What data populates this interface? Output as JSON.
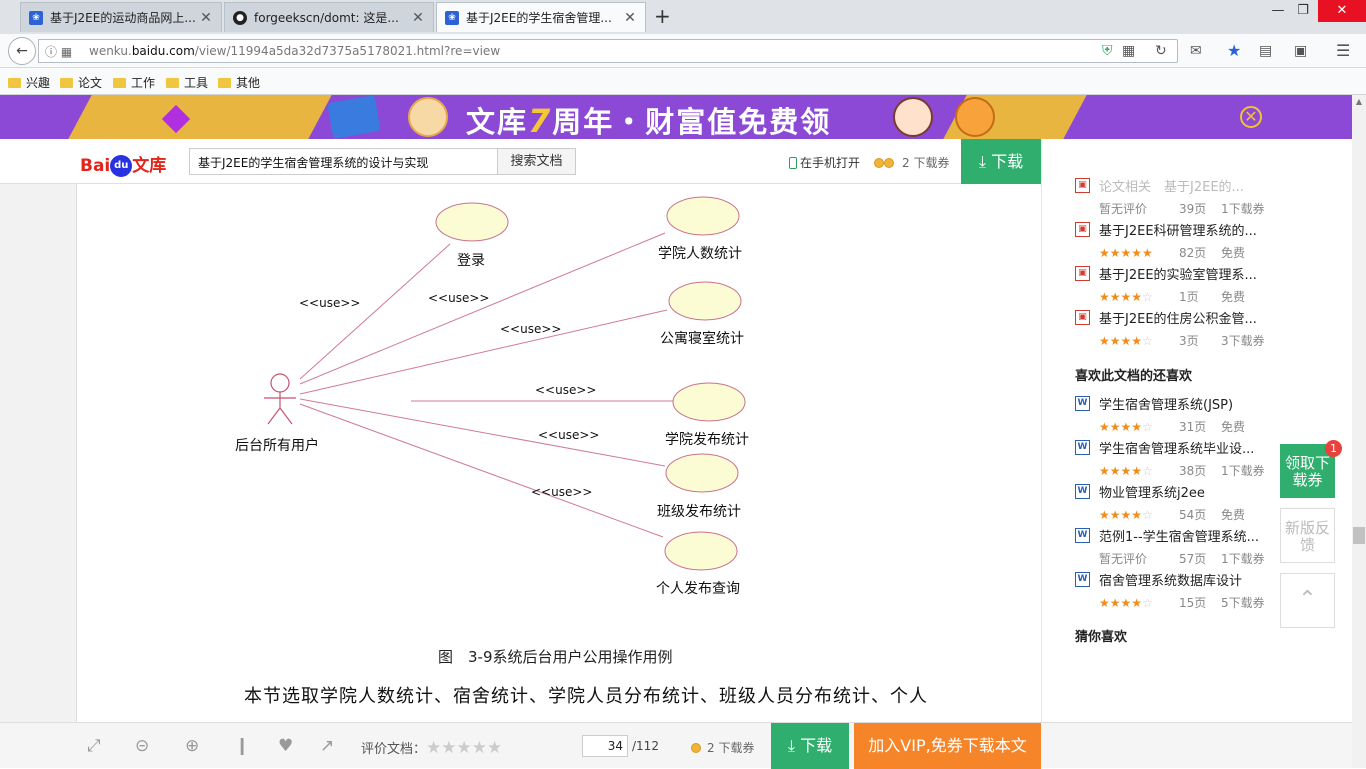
{
  "browser": {
    "tabs": [
      {
        "title": "基于J2EE的运动商品网上..."
      },
      {
        "title": "forgeekscn/domt: 这是..."
      },
      {
        "title": "基于J2EE的学生宿舍管理..."
      }
    ],
    "url_prefix": "wenku.",
    "url_domain": "baidu.com",
    "url_path": "/view/11994a5da32d7375a5178021.html?re=view",
    "bookmarks": [
      "兴趣",
      "论文",
      "工作",
      "工具",
      "其他"
    ]
  },
  "banner": {
    "headline_left": "文库",
    "headline_num": "7",
    "headline_right": "周年・财富值免费领"
  },
  "header": {
    "logo_text": "Bai",
    "logo_du": "du",
    "logo_wk": "文库",
    "search_value": "基于J2EE的学生宿舍管理系统的设计与实现",
    "search_button": "搜索文档",
    "mobile_open": "在手机打开",
    "quota": "2 下载券",
    "download": "下载"
  },
  "diagram": {
    "actor": "后台所有用户",
    "use_label": "<<use>>",
    "usecases": [
      "登录",
      "学院人数统计",
      "公寓寝室统计",
      "学院发布统计",
      "班级发布统计",
      "个人发布查询"
    ]
  },
  "document": {
    "caption": "图　3-9系统后台用户公用操作用例",
    "body": "本节选取学院人数统计、宿舍统计、学院人员分布统计、班级人员分布统计、个人"
  },
  "sidebar": {
    "faded_item": "论文相关　基于J2EE的...",
    "related": [
      {
        "title": "基于J2EE科研管理系统的...",
        "rating": 4.5,
        "pages": "82页",
        "cost": "免费"
      },
      {
        "title": "基于J2EE的实验室管理系...",
        "rating": 3.5,
        "pages": "1页",
        "cost": "免费"
      },
      {
        "title": "基于J2EE的住房公积金管...",
        "rating": 3.5,
        "pages": "3页",
        "cost": "3下载券"
      }
    ],
    "top_item_meta": {
      "rating_text": "暂无评价",
      "pages": "39页",
      "cost": "1下载券"
    },
    "also_liked_title": "喜欢此文档的还喜欢",
    "also_liked": [
      {
        "title": "学生宿舍管理系统(JSP)",
        "rating": 4,
        "rating_text": "",
        "pages": "31页",
        "cost": "免费"
      },
      {
        "title": "学生宿舍管理系统毕业设...",
        "rating": 4,
        "rating_text": "",
        "pages": "38页",
        "cost": "1下载券"
      },
      {
        "title": "物业管理系统j2ee",
        "rating": 4,
        "rating_text": "",
        "pages": "54页",
        "cost": "免费"
      },
      {
        "title": "范例1--学生宿舍管理系统...",
        "rating": 0,
        "rating_text": "暂无评价",
        "pages": "57页",
        "cost": "1下载券"
      },
      {
        "title": "宿舍管理系统数据库设计",
        "rating": 4,
        "rating_text": "",
        "pages": "15页",
        "cost": "5下载券"
      }
    ],
    "guess_title": "猜你喜欢"
  },
  "floats": {
    "coupon": "领取下载券",
    "coupon_badge": "1",
    "feedback": "新版反馈"
  },
  "bottombar": {
    "rate_label": "评价文档：",
    "page_current": "34",
    "page_total": "/112",
    "quota": "2 下载券",
    "download": "下载",
    "vip": "加入VIP,免券下载本文"
  }
}
